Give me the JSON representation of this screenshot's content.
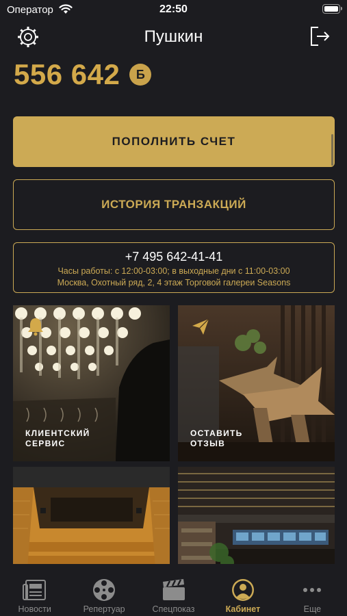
{
  "status_bar": {
    "carrier": "Оператор",
    "time": "22:50"
  },
  "header": {
    "title": "Пушкин",
    "settings_icon": "gear-icon",
    "logout_icon": "logout-icon"
  },
  "balance": {
    "value": "556 642",
    "currency_badge": "Б"
  },
  "actions": {
    "top_up_label": "ПОПОЛНИТЬ СЧЕТ",
    "history_label": "ИСТОРИЯ ТРАНЗАКЦИЙ"
  },
  "contact": {
    "phone": "+7 495 642-41-41",
    "hours": "Часы работы: с 12:00-03:00; в выходные дни с 11:00-03:00",
    "address": "Москва, Охотный ряд, 2, 4 этаж Торговой галереи Seasons"
  },
  "tiles": [
    {
      "label": "КЛИЕНТСКИЙ\nСЕРВИС",
      "icon": "bell-icon"
    },
    {
      "label": "ОСТАВИТЬ\nОТЗЫВ",
      "icon": "paper-plane-icon"
    },
    {
      "label": "",
      "icon": ""
    },
    {
      "label": "",
      "icon": ""
    }
  ],
  "tab_bar": {
    "items": [
      {
        "label": "Новости",
        "icon": "newspaper-icon",
        "active": false
      },
      {
        "label": "Репертуар",
        "icon": "film-reel-icon",
        "active": false
      },
      {
        "label": "Спецпоказ",
        "icon": "clapperboard-icon",
        "active": false
      },
      {
        "label": "Кабинет",
        "icon": "profile-icon",
        "active": true
      },
      {
        "label": "Еще",
        "icon": "more-icon",
        "active": false
      }
    ]
  },
  "colors": {
    "accent": "#ccaa55",
    "background": "#1c1c20",
    "inactive": "#8c8c8c"
  }
}
